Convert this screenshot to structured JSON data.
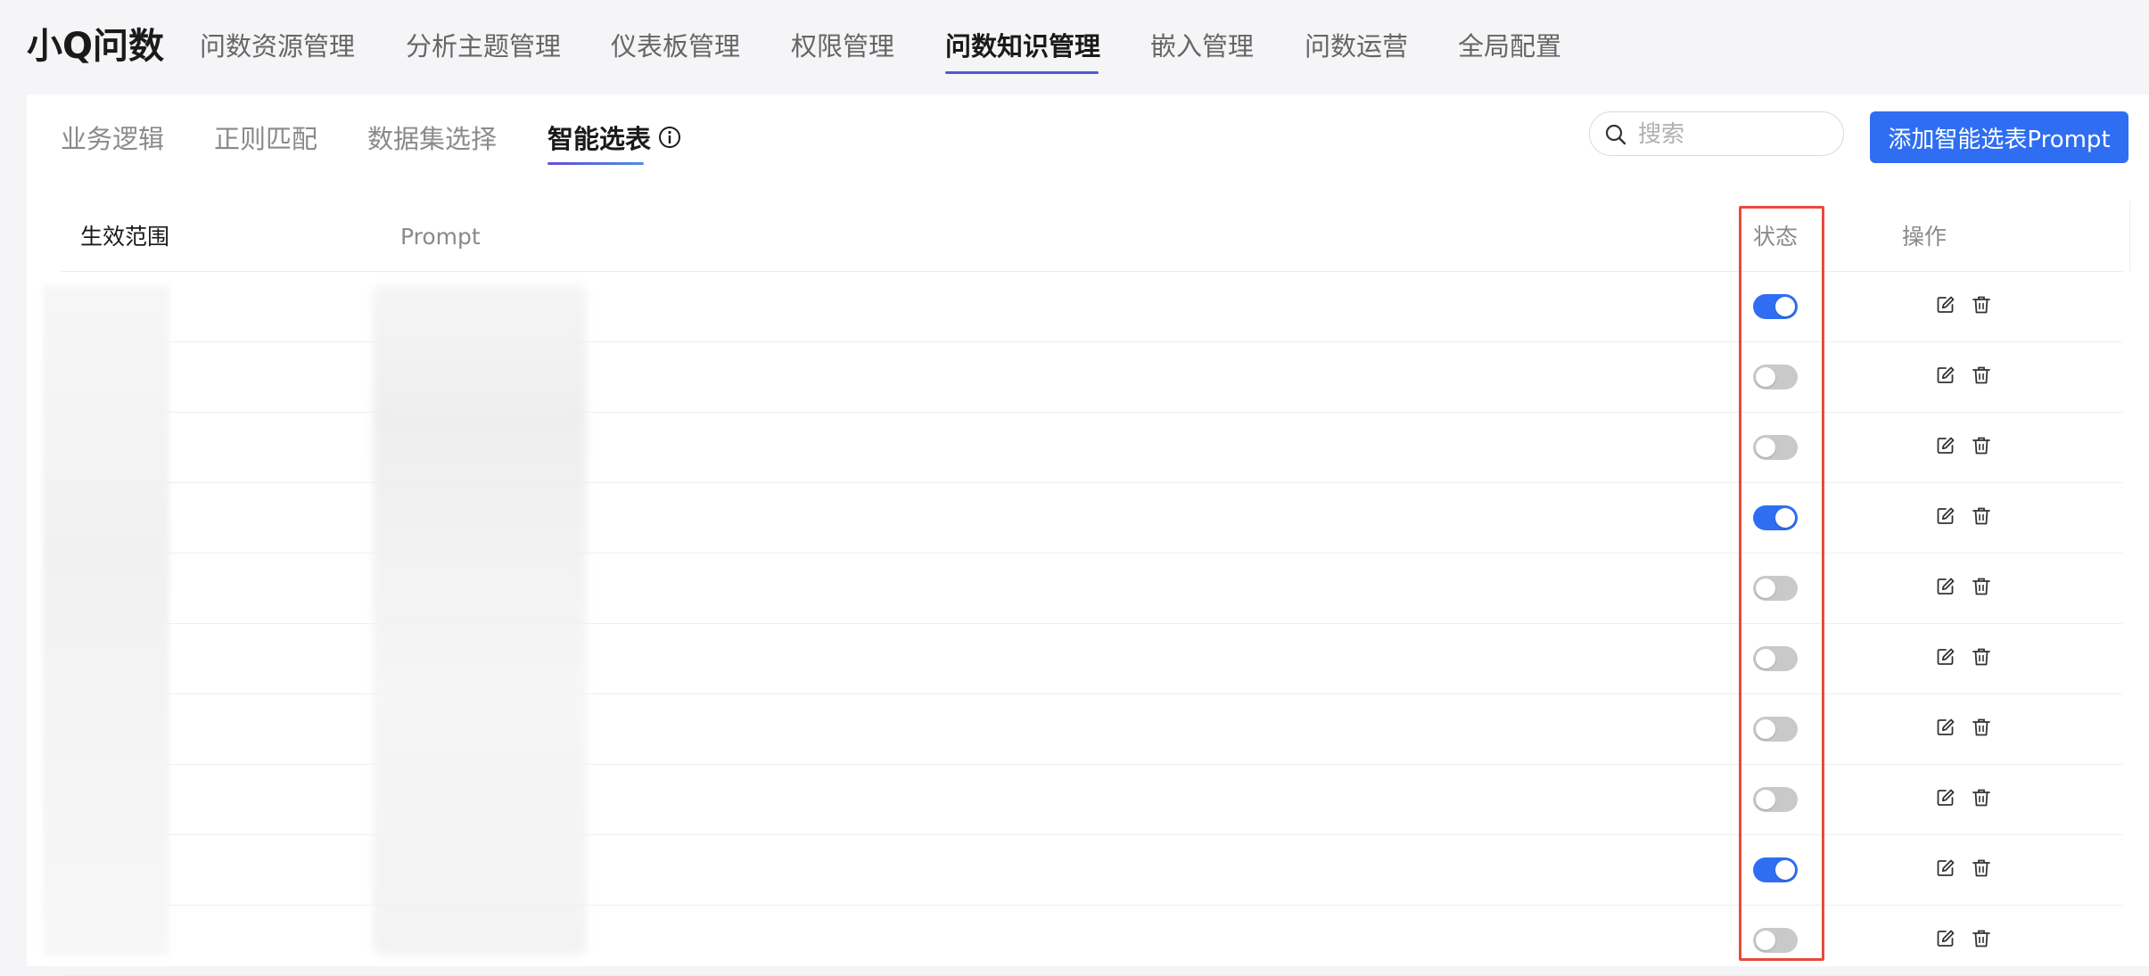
{
  "app": {
    "brand": "小Q问数"
  },
  "nav": {
    "items": [
      "问数资源管理",
      "分析主题管理",
      "仪表板管理",
      "权限管理",
      "问数知识管理",
      "嵌入管理",
      "问数运营",
      "全局配置"
    ],
    "active_index": 4
  },
  "subtabs": {
    "items": [
      "业务逻辑",
      "正则匹配",
      "数据集选择",
      "智能选表"
    ],
    "active_index": 3,
    "info_icon": "info-circle-icon"
  },
  "search": {
    "placeholder": "搜索",
    "value": ""
  },
  "add_button": {
    "label": "添加智能选表Prompt"
  },
  "table": {
    "headers": {
      "scope": "生效范围",
      "prompt": "Prompt",
      "status": "状态",
      "actions": "操作"
    },
    "rows": [
      {
        "scope": "",
        "prompt": "",
        "enabled": true
      },
      {
        "scope": "",
        "prompt": "",
        "enabled": false
      },
      {
        "scope": "",
        "prompt": "",
        "enabled": false
      },
      {
        "scope": "",
        "prompt": "",
        "enabled": true
      },
      {
        "scope": "",
        "prompt": "",
        "enabled": false
      },
      {
        "scope": "",
        "prompt": "",
        "enabled": false
      },
      {
        "scope": "",
        "prompt": "",
        "enabled": false
      },
      {
        "scope": "",
        "prompt": "",
        "enabled": false
      },
      {
        "scope": "",
        "prompt": "",
        "enabled": true
      },
      {
        "scope": "",
        "prompt": "",
        "enabled": false
      }
    ],
    "row_action_icons": [
      "edit-icon",
      "trash-icon"
    ]
  },
  "colors": {
    "accent": "#2f6ef2",
    "toggle_off": "#c9c9c9",
    "highlight": "#e64b3c",
    "active_tab_underline": "#4a5bd6"
  }
}
